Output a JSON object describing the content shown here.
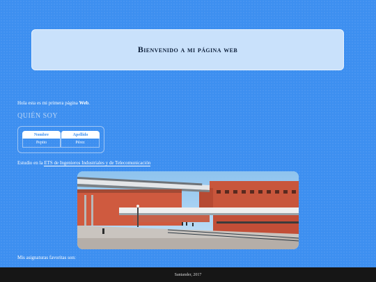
{
  "header": {
    "title": "Bienvenido a mi página web"
  },
  "intro": {
    "text": "Hola esta es mi primera página ",
    "bold": "Web",
    "end": "."
  },
  "about": {
    "title": "QUIÉN SOY",
    "columns": [
      "Nombre",
      "Apellido"
    ],
    "rows": [
      [
        "Pepito",
        "Pérez"
      ]
    ]
  },
  "study": {
    "text": "Estudio en la ",
    "link": "ETS de Ingenieros Industriales y de Telecomunicación"
  },
  "photo": {
    "subject": "university-building-photo"
  },
  "favorites": {
    "text": "Mis asignaturas favoritas son:"
  },
  "footer": {
    "text": "Santander, 2017"
  },
  "colors": {
    "background": "#3d8ff0",
    "banner": "#c9e1fb",
    "footer": "#161616"
  }
}
